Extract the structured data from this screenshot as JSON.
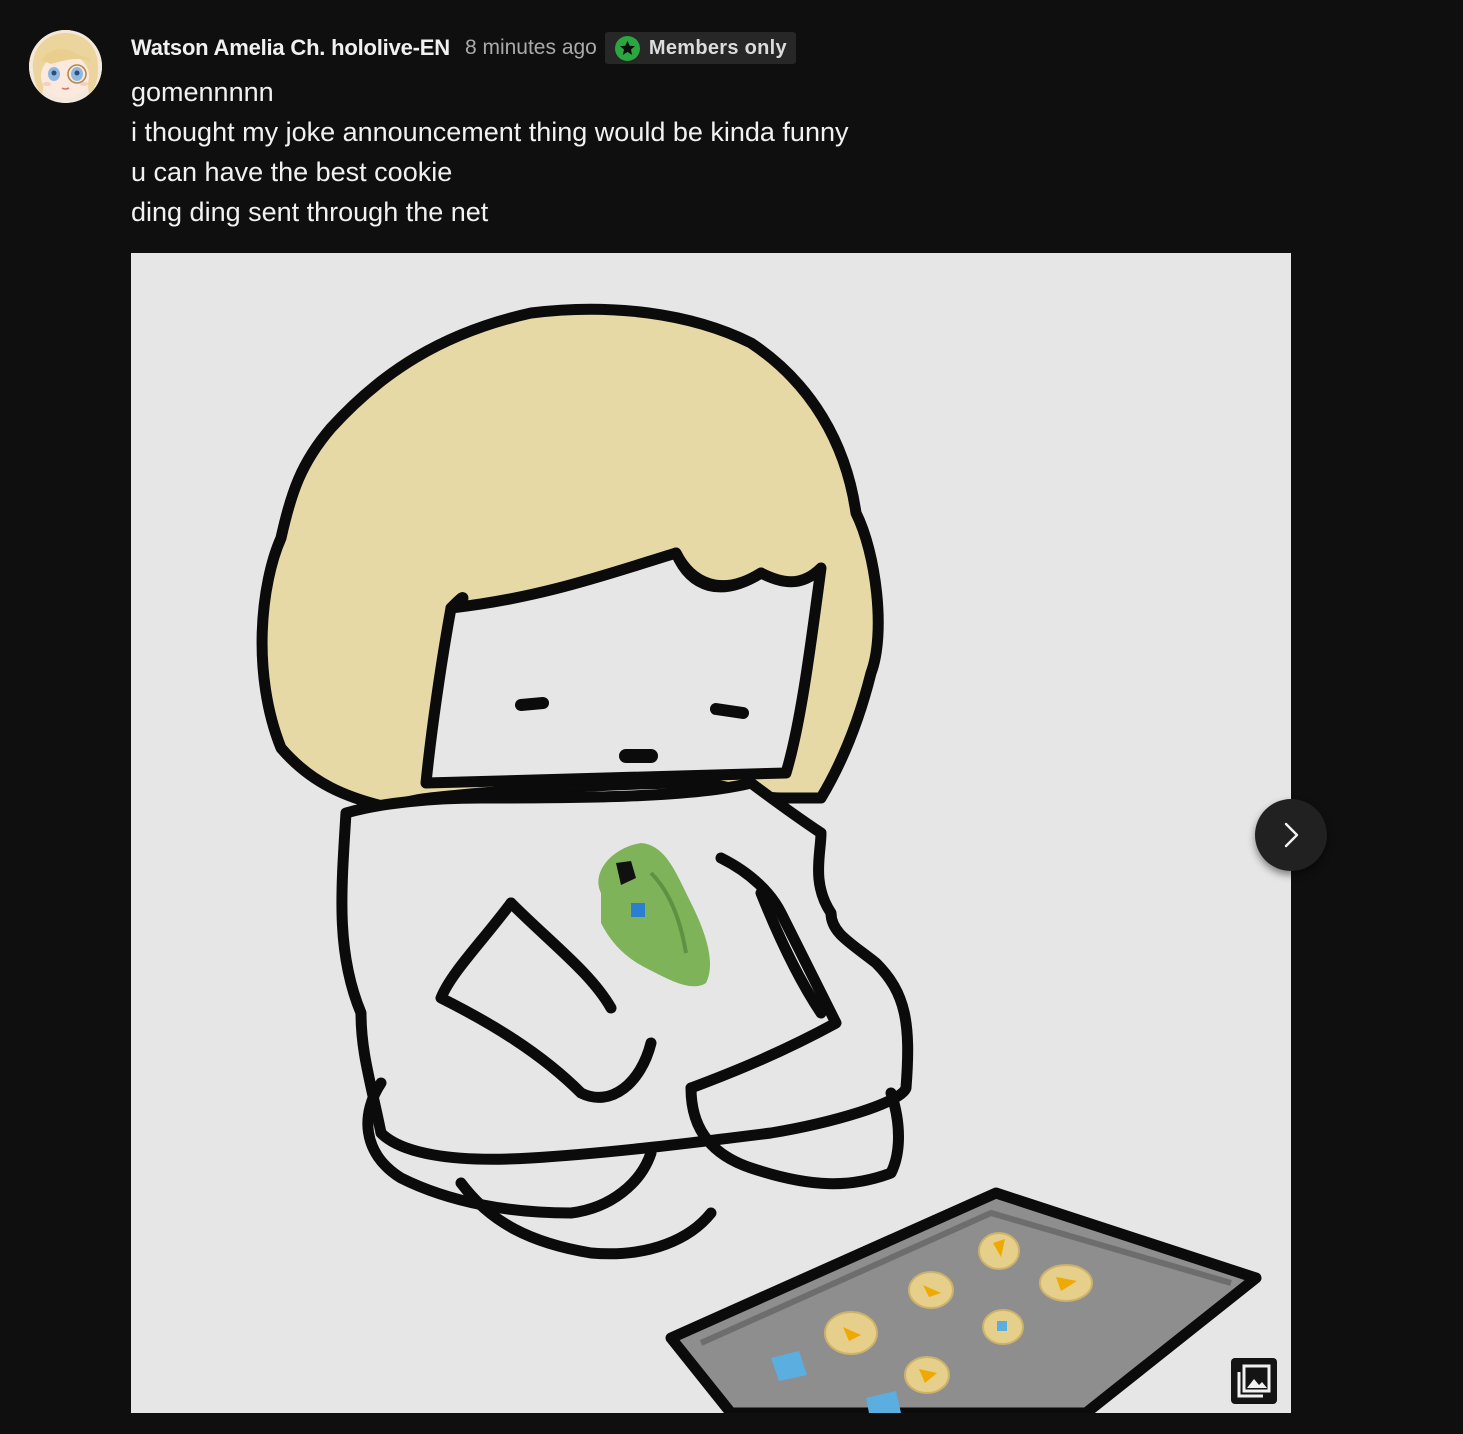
{
  "post": {
    "author": "Watson Amelia Ch. hololive-EN",
    "timestamp": "8 minutes ago",
    "badge": {
      "label": "Members only",
      "icon": "star-badge-icon",
      "color": "#2ba640"
    },
    "body_lines": [
      "gomennnnn",
      "i thought my joke announcement thing would be kinda funny",
      "u can have the best cookie",
      "ding ding sent through the net"
    ],
    "image": {
      "description_icon": "gallery-icon",
      "next_icon": "chevron-right-icon"
    }
  },
  "colors": {
    "background": "#0f0f0f",
    "text_primary": "#f1f1f1",
    "text_secondary": "#aaaaaa",
    "badge_bg": "#272727",
    "image_bg": "#e6e6e6",
    "hair": "#e6d9a6",
    "tray": "#8e8e8e",
    "cookie": "#e6cf8a",
    "shirt_icon": "#7fb35a"
  }
}
